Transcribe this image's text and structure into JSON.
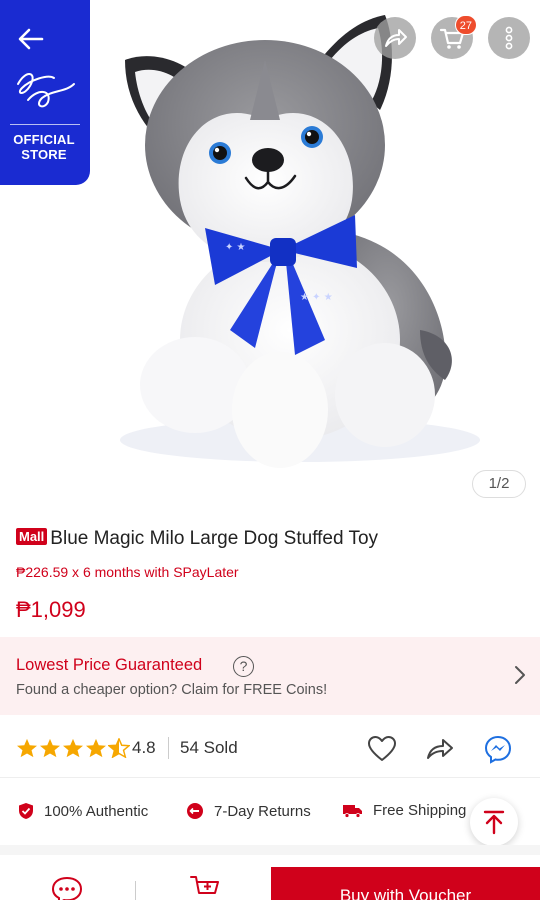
{
  "store": {
    "badge_line1": "OFFICIAL",
    "badge_line2": "STORE",
    "logo_text": "Blue Magic"
  },
  "header": {
    "cart_count": "27"
  },
  "gallery": {
    "pager": "1/2"
  },
  "product": {
    "mall_tag": "Mall",
    "title": "Blue Magic Milo Large Dog Stuffed Toy",
    "installment": "₱226.59 x 6 months with SPayLater",
    "price": "₱1,099"
  },
  "guarantee": {
    "title": "Lowest Price Guaranteed",
    "help": "?",
    "subtitle": "Found a cheaper option? Claim for FREE Coins!"
  },
  "rating": {
    "value": "4.8",
    "stars": 4.5,
    "sold": "54 Sold"
  },
  "features": [
    {
      "label": "100% Authentic",
      "icon": "shield-check-icon"
    },
    {
      "label": "7-Day Returns",
      "icon": "return-icon"
    },
    {
      "label": "Free Shipping",
      "icon": "truck-icon"
    }
  ],
  "bottom_bar": {
    "buy_label": "Buy with Voucher"
  },
  "colors": {
    "brand_red": "#d0011b",
    "store_blue": "#1a2bd1",
    "star": "#f6a700"
  }
}
